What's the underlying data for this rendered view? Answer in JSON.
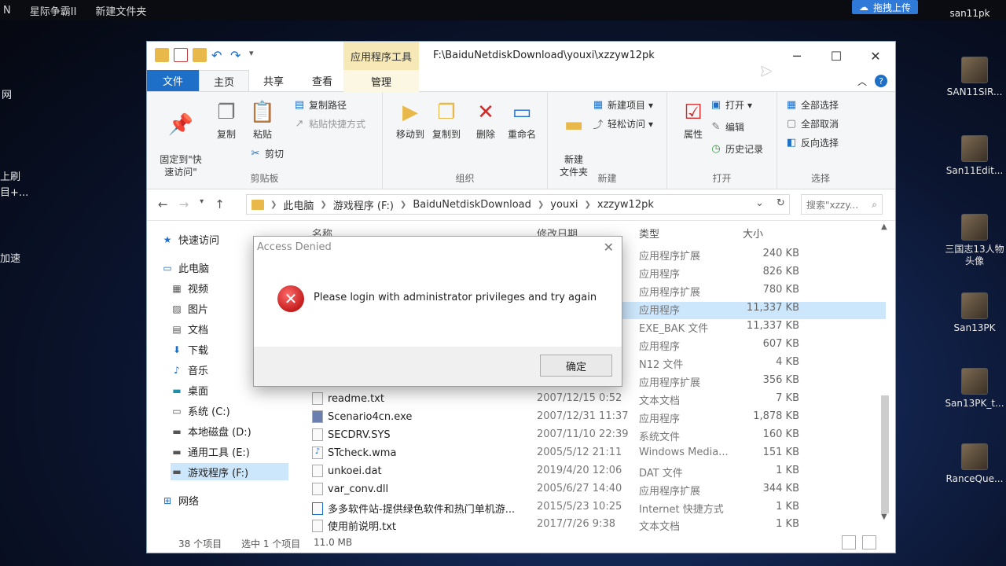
{
  "desktop": {
    "top_items": [
      "N",
      "星际争霸II",
      "新建文件夹"
    ],
    "upload_button": "拖拽上传",
    "top_right_label": "san11pk",
    "left_labels": [
      "网",
      "上刷",
      "目+...",
      "加速"
    ],
    "icons": [
      {
        "label": "SAN11SIR..."
      },
      {
        "label": "San11Edit..."
      },
      {
        "label": "三国志13人物头像"
      },
      {
        "label": "San13PK"
      },
      {
        "label": "San13PK_t..."
      },
      {
        "label": "RanceQue..."
      }
    ]
  },
  "window": {
    "title_path": "F:\\BaiduNetdiskDownload\\youxi\\xzzyw12pk",
    "app_tools_tab": "应用程序工具",
    "manage_tab": "管理",
    "tabs": [
      "文件",
      "主页",
      "共享",
      "查看"
    ],
    "active_tab": "主页"
  },
  "ribbon": {
    "clipboard": {
      "pin": "固定到\"快\n速访问\"",
      "copy": "复制",
      "paste": "粘贴",
      "copy_path": "复制路径",
      "paste_shortcut": "粘贴快捷方式",
      "cut": "剪切",
      "label": "剪贴板"
    },
    "organize": {
      "move_to": "移动到",
      "copy_to": "复制到",
      "delete": "删除",
      "rename": "重命名",
      "label": "组织"
    },
    "new": {
      "new_folder": "新建\n文件夹",
      "new_item": "新建项目",
      "easy_access": "轻松访问",
      "label": "新建"
    },
    "open": {
      "properties": "属性",
      "open": "打开",
      "edit": "编辑",
      "history": "历史记录",
      "label": "打开"
    },
    "select": {
      "select_all": "全部选择",
      "select_none": "全部取消",
      "invert": "反向选择",
      "label": "选择"
    }
  },
  "address": {
    "crumbs": [
      "此电脑",
      "游戏程序 (F:)",
      "BaiduNetdiskDownload",
      "youxi",
      "xzzyw12pk"
    ],
    "search_placeholder": "搜索\"xzzy..."
  },
  "nav": {
    "items": [
      {
        "label": "快速访问",
        "icon": "star-icon"
      },
      {
        "label": "此电脑",
        "icon": "computer-icon"
      },
      {
        "label": "视频",
        "icon": "video-icon"
      },
      {
        "label": "图片",
        "icon": "picture-icon"
      },
      {
        "label": "文档",
        "icon": "document-icon"
      },
      {
        "label": "下载",
        "icon": "download-icon"
      },
      {
        "label": "音乐",
        "icon": "music-icon"
      },
      {
        "label": "桌面",
        "icon": "desktop-icon"
      },
      {
        "label": "系统 (C:)",
        "icon": "drive-icon"
      },
      {
        "label": "本地磁盘 (D:)",
        "icon": "drive-icon"
      },
      {
        "label": "通用工具 (E:)",
        "icon": "drive-icon"
      },
      {
        "label": "游戏程序 (F:)",
        "icon": "drive-icon"
      },
      {
        "label": "网络",
        "icon": "network-icon"
      }
    ]
  },
  "columns": {
    "name": "名称",
    "date": "修改日期",
    "type": "类型",
    "size": "大小"
  },
  "files": [
    {
      "name": "",
      "date": "",
      "type": "应用程序扩展",
      "size": "240 KB"
    },
    {
      "name": "",
      "date": "",
      "type": "应用程序",
      "size": "826 KB"
    },
    {
      "name": "",
      "date": "",
      "type": "应用程序扩展",
      "size": "780 KB"
    },
    {
      "name": "",
      "date": "",
      "type": "应用程序",
      "size": "11,337 KB"
    },
    {
      "name": "",
      "date": "",
      "type": "EXE_BAK 文件",
      "size": "11,337 KB"
    },
    {
      "name": "",
      "date": "",
      "type": "应用程序",
      "size": "607 KB"
    },
    {
      "name": "",
      "date": "",
      "type": "N12 文件",
      "size": "4 KB"
    },
    {
      "name": "",
      "date": "",
      "type": "应用程序扩展",
      "size": "356 KB"
    },
    {
      "name": "readme.txt",
      "date": "2007/12/15 0:52",
      "type": "文本文档",
      "size": "7 KB"
    },
    {
      "name": "Scenario4cn.exe",
      "date": "2007/12/31 11:37",
      "type": "应用程序",
      "size": "1,878 KB"
    },
    {
      "name": "SECDRV.SYS",
      "date": "2007/11/10 22:39",
      "type": "系统文件",
      "size": "160 KB"
    },
    {
      "name": "STcheck.wma",
      "date": "2005/5/12 21:11",
      "type": "Windows Media...",
      "size": "151 KB"
    },
    {
      "name": "unkoei.dat",
      "date": "2019/4/20 12:06",
      "type": "DAT 文件",
      "size": "1 KB"
    },
    {
      "name": "var_conv.dll",
      "date": "2005/6/27 14:40",
      "type": "应用程序扩展",
      "size": "344 KB"
    },
    {
      "name": "多多软件站-提供绿色软件和热门单机游...",
      "date": "2015/5/23 10:25",
      "type": "Internet 快捷方式",
      "size": "1 KB"
    },
    {
      "name": "使用前说明.txt",
      "date": "2017/7/26 9:38",
      "type": "文本文档",
      "size": "1 KB"
    }
  ],
  "status": {
    "count": "38 个项目",
    "selected": "选中 1 个项目",
    "size": "11.0 MB"
  },
  "dialog": {
    "title": "Access Denied",
    "message": "Please login with administrator privileges and try again",
    "ok": "确定"
  }
}
